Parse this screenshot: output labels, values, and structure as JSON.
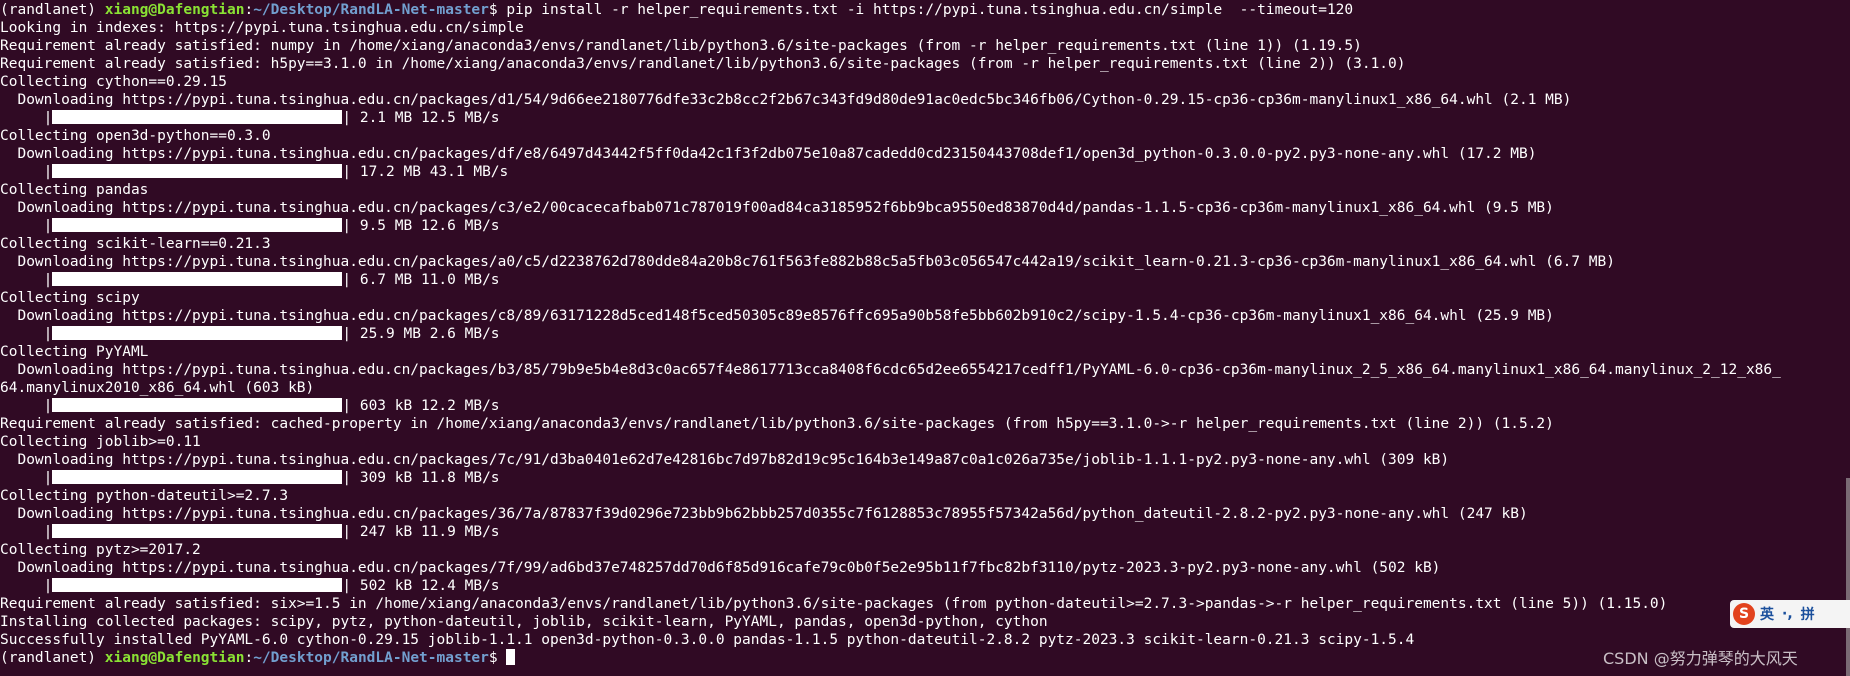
{
  "prompt": {
    "env": "(randlanet) ",
    "user_host": "xiang@Dafengtian",
    "sep": ":",
    "path": "~/Desktop/RandLA-Net-master",
    "dollar": "$ "
  },
  "lines": {
    "l00": "pip install -r helper_requirements.txt -i https://pypi.tuna.tsinghua.edu.cn/simple  --timeout=120",
    "l01": "Looking in indexes: https://pypi.tuna.tsinghua.edu.cn/simple",
    "l02": "Requirement already satisfied: numpy in /home/xiang/anaconda3/envs/randlanet/lib/python3.6/site-packages (from -r helper_requirements.txt (line 1)) (1.19.5)",
    "l03": "Requirement already satisfied: h5py==3.1.0 in /home/xiang/anaconda3/envs/randlanet/lib/python3.6/site-packages (from -r helper_requirements.txt (line 2)) (3.1.0)",
    "l04": "Collecting cython==0.29.15",
    "l05": "  Downloading https://pypi.tuna.tsinghua.edu.cn/packages/d1/54/9d66ee2180776dfe33c2b8cc2f2b67c343fd9d80de91ac0edc5bc346fb06/Cython-0.29.15-cp36-cp36m-manylinux1_x86_64.whl (2.1 MB)",
    "l06": "| 2.1 MB 12.5 MB/s",
    "l07": "Collecting open3d-python==0.3.0",
    "l08": "  Downloading https://pypi.tuna.tsinghua.edu.cn/packages/df/e8/6497d43442f5ff0da42c1f3f2db075e10a87cadedd0cd23150443708def1/open3d_python-0.3.0.0-py2.py3-none-any.whl (17.2 MB)",
    "l09": "| 17.2 MB 43.1 MB/s",
    "l10": "Collecting pandas",
    "l11": "  Downloading https://pypi.tuna.tsinghua.edu.cn/packages/c3/e2/00cacecafbab071c787019f00ad84ca3185952f6bb9bca9550ed83870d4d/pandas-1.1.5-cp36-cp36m-manylinux1_x86_64.whl (9.5 MB)",
    "l12": "| 9.5 MB 12.6 MB/s",
    "l13": "Collecting scikit-learn==0.21.3",
    "l14": "  Downloading https://pypi.tuna.tsinghua.edu.cn/packages/a0/c5/d2238762d780dde84a20b8c761f563fe882b88c5a5fb03c056547c442a19/scikit_learn-0.21.3-cp36-cp36m-manylinux1_x86_64.whl (6.7 MB)",
    "l15": "| 6.7 MB 11.0 MB/s",
    "l16": "Collecting scipy",
    "l17": "  Downloading https://pypi.tuna.tsinghua.edu.cn/packages/c8/89/63171228d5ced148f5ced50305c89e8576ffc695a90b58fe5bb602b910c2/scipy-1.5.4-cp36-cp36m-manylinux1_x86_64.whl (25.9 MB)",
    "l18": "| 25.9 MB 2.6 MB/s",
    "l19": "Collecting PyYAML",
    "l20": "  Downloading https://pypi.tuna.tsinghua.edu.cn/packages/b3/85/79b9e5b4e8d3c0ac657f4e8617713cca8408f6cdc65d2ee6554217cedff1/PyYAML-6.0-cp36-cp36m-manylinux_2_5_x86_64.manylinux1_x86_64.manylinux_2_12_x86_",
    "l21": "64.manylinux2010_x86_64.whl (603 kB)",
    "l22": "| 603 kB 12.2 MB/s",
    "l23": "Requirement already satisfied: cached-property in /home/xiang/anaconda3/envs/randlanet/lib/python3.6/site-packages (from h5py==3.1.0->-r helper_requirements.txt (line 2)) (1.5.2)",
    "l24": "Collecting joblib>=0.11",
    "l25": "  Downloading https://pypi.tuna.tsinghua.edu.cn/packages/7c/91/d3ba0401e62d7e42816bc7d97b82d19c95c164b3e149a87c0a1c026a735e/joblib-1.1.1-py2.py3-none-any.whl (309 kB)",
    "l26": "| 309 kB 11.8 MB/s",
    "l27": "Collecting python-dateutil>=2.7.3",
    "l28": "  Downloading https://pypi.tuna.tsinghua.edu.cn/packages/36/7a/87837f39d0296e723bb9b62bbb257d0355c7f6128853c78955f57342a56d/python_dateutil-2.8.2-py2.py3-none-any.whl (247 kB)",
    "l29": "| 247 kB 11.9 MB/s",
    "l30": "Collecting pytz>=2017.2",
    "l31": "  Downloading https://pypi.tuna.tsinghua.edu.cn/packages/7f/99/ad6bd37e748257dd70d6f85d916cafe79c0b0f5e2e95b11f7fbc82bf3110/pytz-2023.3-py2.py3-none-any.whl (502 kB)",
    "l32": "| 502 kB 12.4 MB/s",
    "l33": "Requirement already satisfied: six>=1.5 in /home/xiang/anaconda3/envs/randlanet/lib/python3.6/site-packages (from python-dateutil>=2.7.3->pandas->-r helper_requirements.txt (line 5)) (1.15.0)",
    "l34": "Installing collected packages: scipy, pytz, python-dateutil, joblib, scikit-learn, PyYAML, pandas, open3d-python, cython",
    "l35": "Successfully installed PyYAML-6.0 cython-0.29.15 joblib-1.1.1 open3d-python-0.3.0.0 pandas-1.1.5 python-dateutil-2.8.2 pytz-2023.3 scikit-learn-0.21.3 scipy-1.5.4"
  },
  "bar_indent": "     |",
  "progress": {
    "cython": 1.0,
    "open3d": 1.0,
    "pandas": 1.0,
    "sklearn": 1.0,
    "scipy": 1.0,
    "pyyaml": 1.0,
    "joblib": 1.0,
    "dateutil": 1.0,
    "pytz": 1.0
  },
  "ime": {
    "logo": "S",
    "lang": "英",
    "punct": "·,",
    "pinyin": "拼"
  },
  "watermark": "CSDN @努力弹琴的大风天",
  "colors": {
    "background": "#300a24",
    "text": "#ffffff",
    "user_host": "#8ae234",
    "path": "#729fcf"
  },
  "icons": {
    "ime_logo": "sogou-logo-icon",
    "cursor": "terminal-cursor-icon"
  }
}
